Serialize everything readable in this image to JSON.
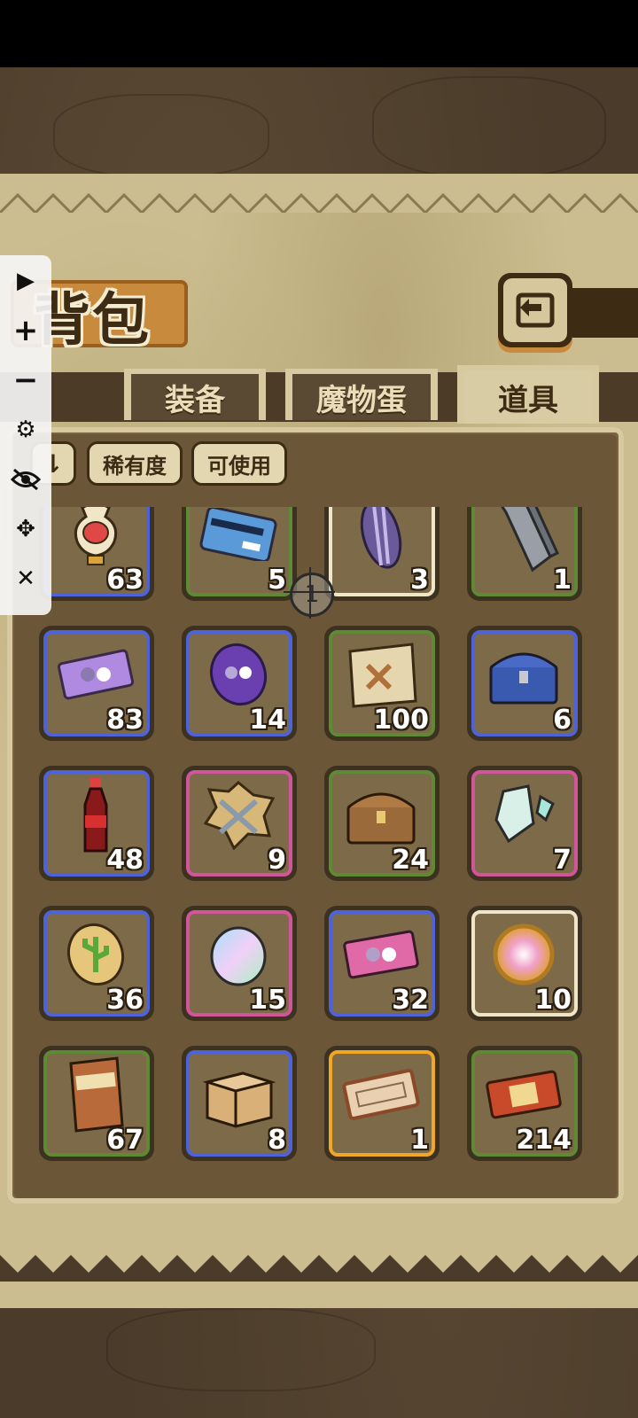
{
  "screen": {
    "title": "背包",
    "back_icon": "⎗"
  },
  "tabs": [
    {
      "label": "装备",
      "active": false
    },
    {
      "label": "魔物蛋",
      "active": false
    },
    {
      "label": "道具",
      "active": true
    }
  ],
  "filters": {
    "sort_icon": "⇂",
    "rarity": "稀有度",
    "usable": "可使用"
  },
  "toolbar": {
    "play": "▶",
    "zoom_in": "+",
    "zoom_out": "−",
    "settings": "⚙",
    "hide": "👁",
    "move": "✥",
    "close": "✕"
  },
  "crosshair_label": "1",
  "items": [
    {
      "name": "vase",
      "qty": "63",
      "rarity": "blue"
    },
    {
      "name": "bank-card",
      "qty": "5",
      "rarity": "green"
    },
    {
      "name": "purple-seed",
      "qty": "3",
      "rarity": "white"
    },
    {
      "name": "stone-pillar",
      "qty": "1",
      "rarity": "green"
    },
    {
      "name": "purple-ticket",
      "qty": "83",
      "rarity": "blue"
    },
    {
      "name": "purple-coin",
      "qty": "14",
      "rarity": "blue"
    },
    {
      "name": "treasure-map",
      "qty": "100",
      "rarity": "green"
    },
    {
      "name": "blue-chest",
      "qty": "6",
      "rarity": "blue"
    },
    {
      "name": "cola-bottle",
      "qty": "48",
      "rarity": "blue"
    },
    {
      "name": "sword-emblem",
      "qty": "9",
      "rarity": "pink"
    },
    {
      "name": "wooden-chest",
      "qty": "24",
      "rarity": "green"
    },
    {
      "name": "rainbow-crystal",
      "qty": "7",
      "rarity": "pink"
    },
    {
      "name": "cactus-cookie",
      "qty": "36",
      "rarity": "blue"
    },
    {
      "name": "rainbow-egg",
      "qty": "15",
      "rarity": "pink"
    },
    {
      "name": "pink-ticket",
      "qty": "32",
      "rarity": "blue"
    },
    {
      "name": "rainbow-orb",
      "qty": "10",
      "rarity": "white"
    },
    {
      "name": "snack-bag",
      "qty": "67",
      "rarity": "green"
    },
    {
      "name": "cardboard-box",
      "qty": "8",
      "rarity": "blue"
    },
    {
      "name": "golden-ticket",
      "qty": "1",
      "rarity": "gold"
    },
    {
      "name": "red-ticket",
      "qty": "214",
      "rarity": "green"
    }
  ],
  "rarity_colors": {
    "blue": "#4f63d8",
    "green": "#5e8a35",
    "white": "#efe6c8",
    "pink": "#d1559a",
    "gold": "#f0a726"
  }
}
